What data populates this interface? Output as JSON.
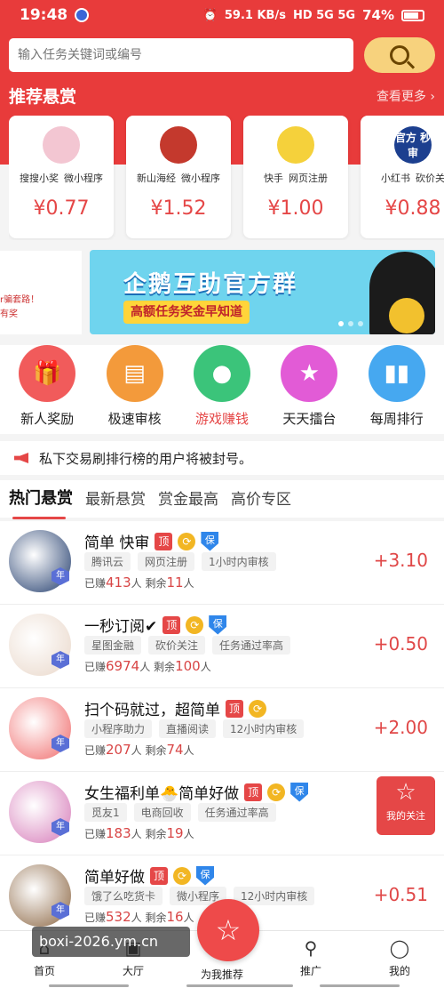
{
  "status_bar": {
    "time": "19:48",
    "net_speed": "59.1 KB/s",
    "signal": "HD 5G 5G",
    "battery": "74%"
  },
  "search": {
    "placeholder": "输入任务关键词或编号"
  },
  "recommend": {
    "title": "推荐悬赏",
    "more": "查看更多 ›",
    "cards": [
      {
        "name": "搜搜小奖",
        "type": "微小程序",
        "price": "¥0.77",
        "logo_color": "#f3c6d2"
      },
      {
        "name": "新山海经",
        "type": "微小程序",
        "price": "¥1.52",
        "logo_color": "#c4392d"
      },
      {
        "name": "快手",
        "type": "网页注册",
        "price": "¥1.00",
        "logo_color": "#f5d13b"
      },
      {
        "name": "小红书",
        "type": "砍价关",
        "price": "¥0.88",
        "logo_color": "#1c3f8f",
        "logo_text": "官方 秒审"
      }
    ]
  },
  "banner": {
    "left_text_1": "r骗套路！",
    "left_text_2": "有奖",
    "title": "企鹅互助官方群",
    "subtitle": "高额任务奖金早知道"
  },
  "quick_actions": [
    {
      "label": "新人奖励",
      "icon": "gift-icon",
      "color": "#f15b5b"
    },
    {
      "label": "极速审核",
      "icon": "document-icon",
      "color": "#f39a3b"
    },
    {
      "label": "游戏赚钱",
      "icon": "gamepad-icon",
      "color": "#3bc47a"
    },
    {
      "label": "天天擂台",
      "icon": "trophy-icon",
      "color": "#e25bd6"
    },
    {
      "label": "每周排行",
      "icon": "bar-chart-icon",
      "color": "#46a8f0"
    }
  ],
  "notice": {
    "text": "私下交易刷排行榜的用户将被封号。"
  },
  "tabs": [
    "热门悬赏",
    "最新悬赏",
    "赏金最高",
    "高价专区"
  ],
  "tasks": [
    {
      "title": "简单 快审",
      "badges": [
        "顶",
        "⟳",
        "保"
      ],
      "tags": [
        "腾讯云",
        "网页注册",
        "1小时内审核"
      ],
      "earned": "413",
      "remaining": "11",
      "reward": "+3.10",
      "avatar_color": "#1f3a6b"
    },
    {
      "title": "一秒订阅✔",
      "badges": [
        "顶",
        "⟳",
        "保"
      ],
      "tags": [
        "星图金融",
        "砍价关注",
        "任务通过率高"
      ],
      "earned": "6974",
      "remaining": "100",
      "reward": "+0.50",
      "avatar_color": "#e9d7c9"
    },
    {
      "title": "扫个码就过，超简单",
      "badges": [
        "顶",
        "⟳"
      ],
      "tags": [
        "小程序助力",
        "直播阅读",
        "12小时内审核"
      ],
      "earned": "207",
      "remaining": "74",
      "reward": "+2.00",
      "avatar_color": "#f06a6a"
    },
    {
      "title": "女生福利单🐣简单好做",
      "badges": [
        "顶",
        "⟳",
        "保"
      ],
      "tags": [
        "觅友1",
        "电商回收",
        "任务通过率高"
      ],
      "earned": "183",
      "remaining": "19",
      "reward": "",
      "avatar_color": "#d67ab8"
    },
    {
      "title": "简单好做",
      "badges": [
        "顶",
        "⟳",
        "保"
      ],
      "tags": [
        "饿了么吃货卡",
        "微小程序",
        "12小时内审核"
      ],
      "earned": "532",
      "remaining": "16",
      "reward": "+0.51",
      "avatar_color": "#8a6440"
    }
  ],
  "labels": {
    "earned_prefix": "已赚",
    "earned_suffix": "人",
    "remaining_prefix": "剩余",
    "remaining_suffix": "人",
    "year_badge": "年"
  },
  "follow_button": {
    "label": "我的关注"
  },
  "bottom_nav": [
    {
      "label": "首页",
      "icon": "home-icon"
    },
    {
      "label": "大厅",
      "icon": "hall-icon"
    },
    {
      "label": "为我推荐",
      "icon": "star-icon"
    },
    {
      "label": "推广",
      "icon": "share-icon"
    },
    {
      "label": "我的",
      "icon": "user-icon"
    }
  ],
  "watermark": "boxi-2026.ym.cn"
}
